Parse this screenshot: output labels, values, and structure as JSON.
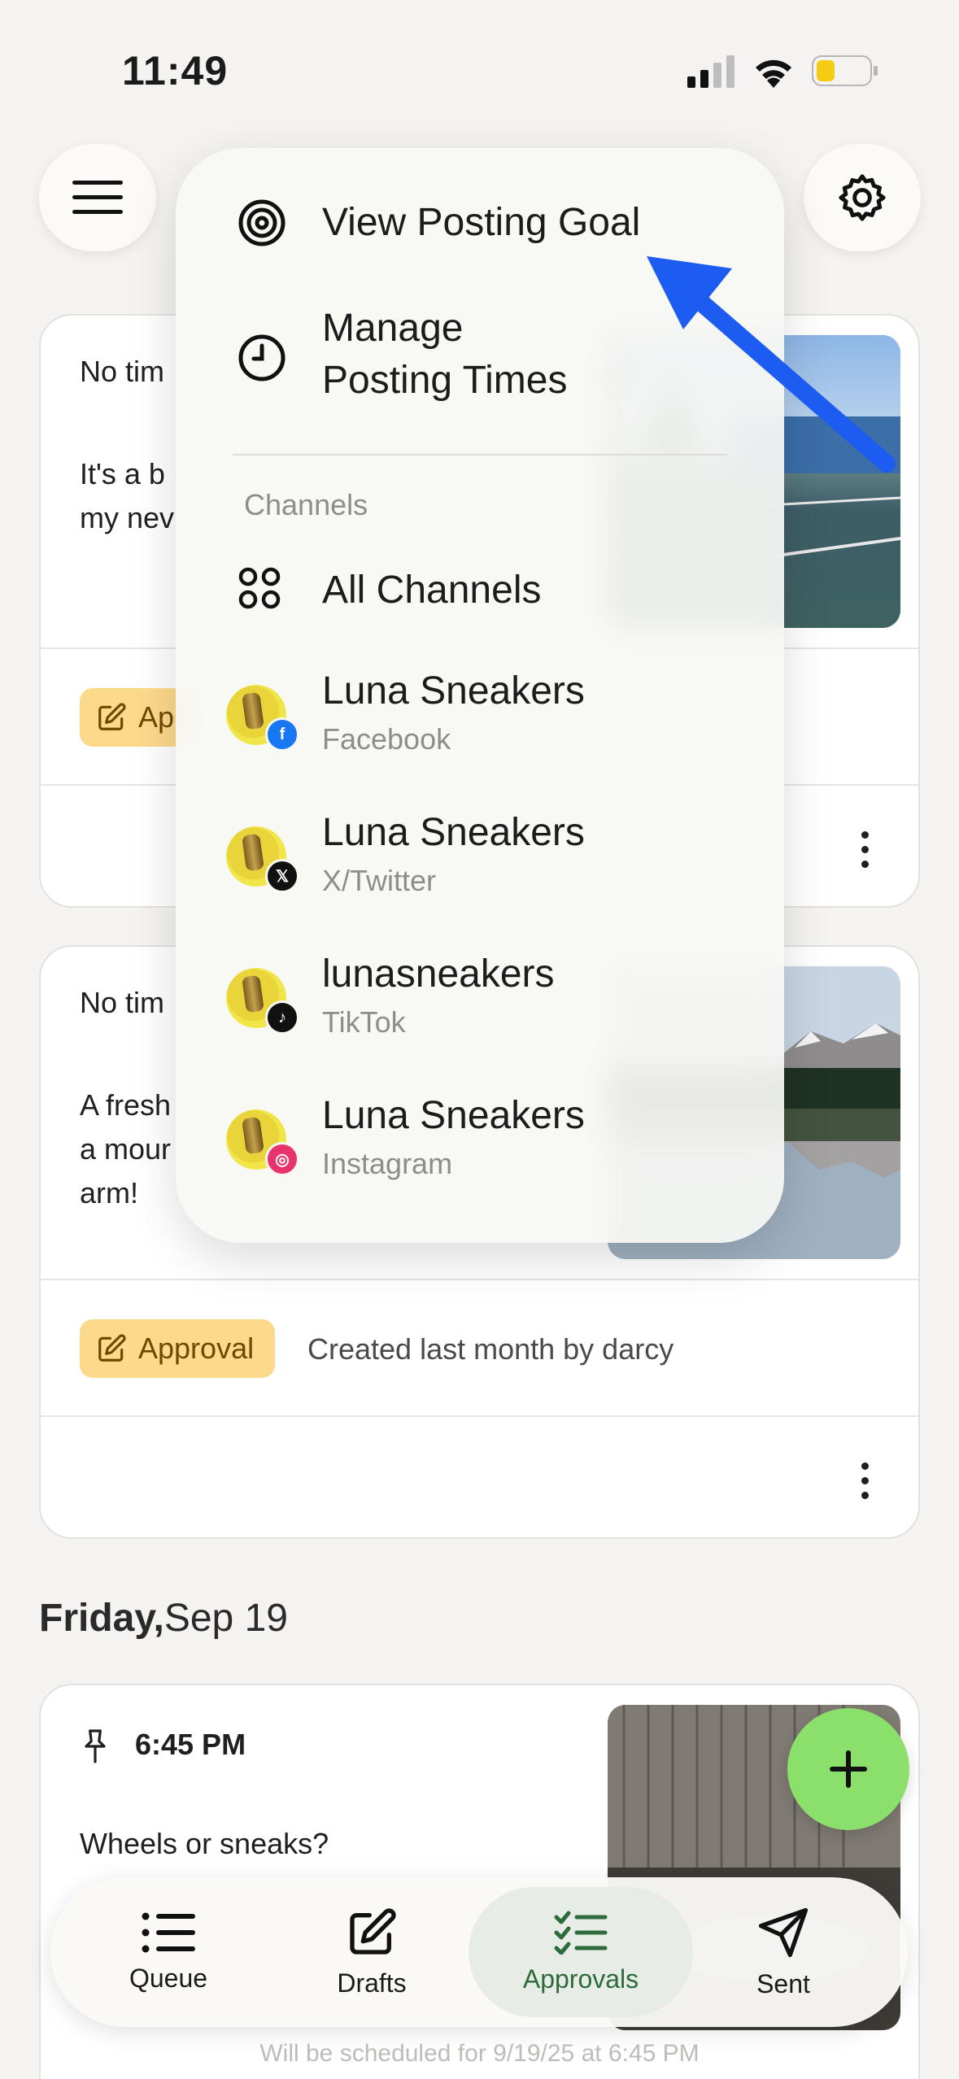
{
  "status_bar": {
    "time": "11:49"
  },
  "cards": [
    {
      "time_label": "No tim",
      "text_lines": [
        "It's a b",
        "my nev"
      ],
      "badge": "Ap"
    },
    {
      "time_label": "No tim",
      "text_lines": [
        "A fresh",
        "a mour",
        "arm!"
      ],
      "badge": "Approval",
      "meta": "Created last month by darcy"
    },
    {
      "time_label": "6:45 PM",
      "text_lines": [
        "Wheels or sneaks?"
      ]
    }
  ],
  "day_header": {
    "day": "Friday,",
    "date": "Sep 19"
  },
  "dropdown": {
    "view_goal": "View Posting Goal",
    "manage_times_line1": "Manage",
    "manage_times_line2": "Posting Times",
    "section_label": "Channels",
    "all_channels": "All Channels",
    "channels": [
      {
        "name": "Luna Sneakers",
        "network": "Facebook",
        "badge_color": "#1877f2",
        "icon": "facebook-icon",
        "glyph": "f"
      },
      {
        "name": "Luna Sneakers",
        "network": "X/Twitter",
        "badge_color": "#111111",
        "icon": "x-twitter-icon",
        "glyph": "𝕏"
      },
      {
        "name": "lunasneakers",
        "network": "TikTok",
        "badge_color": "#111111",
        "icon": "tiktok-icon",
        "glyph": "♪"
      },
      {
        "name": "Luna Sneakers",
        "network": "Instagram",
        "badge_color": "#e8336d",
        "icon": "instagram-icon",
        "glyph": "◎"
      }
    ]
  },
  "bottom_nav": {
    "queue": "Queue",
    "drafts": "Drafts",
    "approvals": "Approvals",
    "sent": "Sent"
  },
  "schedule_note": "Will be scheduled for 9/19/25 at 6:45 PM",
  "colors": {
    "accent_green": "#2e6b3b",
    "fab_green": "#8be06b",
    "approval_yellow": "#fcd98b",
    "annotation_arrow": "#1c5cf0"
  }
}
